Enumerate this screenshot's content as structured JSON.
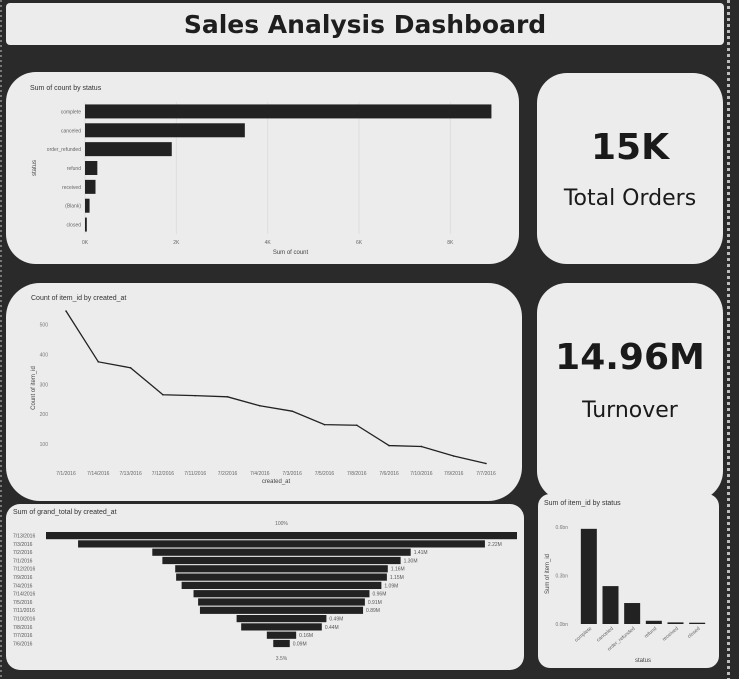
{
  "header": {
    "title": "Sales Analysis Dashboard"
  },
  "kpis": {
    "total_orders": {
      "value": "15K",
      "label": "Total Orders"
    },
    "turnover": {
      "value": "14.96M",
      "label": "Turnover"
    }
  },
  "colors": {
    "bar": "#222222",
    "card": "#ececec",
    "background": "#2a2a2a"
  },
  "chart_data": [
    {
      "id": "status_count",
      "type": "bar",
      "orientation": "horizontal",
      "title": "Sum of count by status",
      "xlabel": "Sum of count",
      "ylabel": "status",
      "categories": [
        "complete",
        "canceled",
        "order_refunded",
        "refund",
        "received",
        "(Blank)",
        "closed"
      ],
      "values": [
        8900,
        3500,
        1900,
        270,
        230,
        100,
        40
      ],
      "xlim": [
        0,
        9000
      ],
      "xticks": [
        0,
        2000,
        4000,
        6000,
        8000
      ],
      "xtick_labels": [
        "0K",
        "2K",
        "4K",
        "6K",
        "8K"
      ]
    },
    {
      "id": "items_by_date",
      "type": "line",
      "title": "Count of item_id by created_at",
      "xlabel": "created_at",
      "ylabel": "Count of item_id",
      "categories": [
        "7/1/2016",
        "7/14/2016",
        "7/13/2016",
        "7/12/2016",
        "7/11/2016",
        "7/2/2016",
        "7/4/2016",
        "7/3/2016",
        "7/5/2016",
        "7/8/2016",
        "7/6/2016",
        "7/10/2016",
        "7/9/2016",
        "7/7/2016"
      ],
      "values": [
        545,
        375,
        355,
        265,
        262,
        258,
        228,
        210,
        165,
        163,
        95,
        92,
        60,
        35
      ],
      "ylim": [
        30,
        545
      ],
      "yticks": [
        100,
        200,
        300,
        400,
        500
      ]
    },
    {
      "id": "grand_total_funnel",
      "type": "bar",
      "orientation": "funnel",
      "title": "Sum of grand_total by created_at",
      "top_label": "100%",
      "bottom_label": "3.5%",
      "categories": [
        "7/13/2016",
        "7/3/2016",
        "7/2/2016",
        "7/1/2016",
        "7/12/2016",
        "7/9/2016",
        "7/4/2016",
        "7/14/2016",
        "7/5/2016",
        "7/11/2016",
        "7/10/2016",
        "7/8/2016",
        "7/7/2016",
        "7/6/2016"
      ],
      "values": [
        2.57,
        2.22,
        1.41,
        1.3,
        1.16,
        1.15,
        1.09,
        0.96,
        0.91,
        0.89,
        0.49,
        0.44,
        0.16,
        0.09
      ],
      "data_labels": [
        "",
        "2.22M",
        "1.41M",
        "1.30M",
        "1.16M",
        "1.15M",
        "1.09M",
        "0.96M",
        "0.91M",
        "0.89M",
        "0.49M",
        "0.44M",
        "0.16M",
        "0.09M"
      ]
    },
    {
      "id": "items_by_status",
      "type": "bar",
      "orientation": "vertical",
      "title": "Sum of item_id by status",
      "xlabel": "status",
      "ylabel": "Sum of item_id",
      "categories": [
        "complete",
        "canceled",
        "order_refunded",
        "refund",
        "received",
        "closed"
      ],
      "values": [
        0.59,
        0.235,
        0.13,
        0.02,
        0.01,
        0.008
      ],
      "ylim": [
        0,
        0.62
      ],
      "yticks": [
        0,
        0.3,
        0.6
      ],
      "ytick_labels": [
        "0.0bn",
        "0.3bn",
        "0.6bn"
      ]
    }
  ]
}
